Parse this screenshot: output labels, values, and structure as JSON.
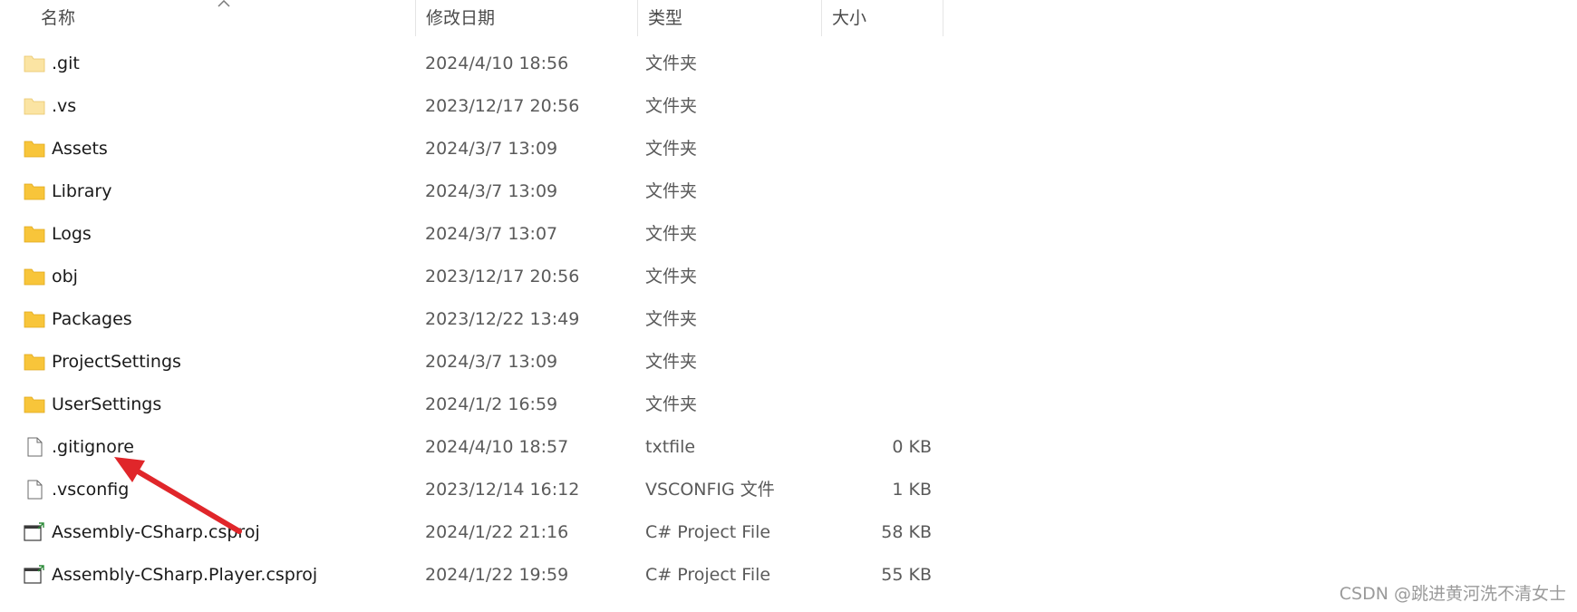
{
  "columns": {
    "name": "名称",
    "date": "修改日期",
    "type": "类型",
    "size": "大小"
  },
  "files": [
    {
      "name": ".git",
      "date": "2024/4/10 18:56",
      "type": "文件夹",
      "size": "",
      "icon": "folder-light-icon"
    },
    {
      "name": ".vs",
      "date": "2023/12/17 20:56",
      "type": "文件夹",
      "size": "",
      "icon": "folder-light-icon"
    },
    {
      "name": "Assets",
      "date": "2024/3/7 13:09",
      "type": "文件夹",
      "size": "",
      "icon": "folder-icon"
    },
    {
      "name": "Library",
      "date": "2024/3/7 13:09",
      "type": "文件夹",
      "size": "",
      "icon": "folder-icon"
    },
    {
      "name": "Logs",
      "date": "2024/3/7 13:07",
      "type": "文件夹",
      "size": "",
      "icon": "folder-icon"
    },
    {
      "name": "obj",
      "date": "2023/12/17 20:56",
      "type": "文件夹",
      "size": "",
      "icon": "folder-icon"
    },
    {
      "name": "Packages",
      "date": "2023/12/22 13:49",
      "type": "文件夹",
      "size": "",
      "icon": "folder-icon"
    },
    {
      "name": "ProjectSettings",
      "date": "2024/3/7 13:09",
      "type": "文件夹",
      "size": "",
      "icon": "folder-icon"
    },
    {
      "name": "UserSettings",
      "date": "2024/1/2 16:59",
      "type": "文件夹",
      "size": "",
      "icon": "folder-icon"
    },
    {
      "name": ".gitignore",
      "date": "2024/4/10 18:57",
      "type": "txtfile",
      "size": "0 KB",
      "icon": "file-icon"
    },
    {
      "name": ".vsconfig",
      "date": "2023/12/14 16:12",
      "type": "VSCONFIG 文件",
      "size": "1 KB",
      "icon": "file-icon"
    },
    {
      "name": "Assembly-CSharp.csproj",
      "date": "2024/1/22 21:16",
      "type": "C# Project File",
      "size": "58 KB",
      "icon": "csproj-icon"
    },
    {
      "name": "Assembly-CSharp.Player.csproj",
      "date": "2024/1/22 19:59",
      "type": "C# Project File",
      "size": "55 KB",
      "icon": "csproj-icon"
    }
  ],
  "watermark": "CSDN @跳进黄河洗不清女士",
  "colors": {
    "folder": "#f8c53a",
    "folder_light": "#fbe4a3",
    "arrow": "#e0262a"
  }
}
